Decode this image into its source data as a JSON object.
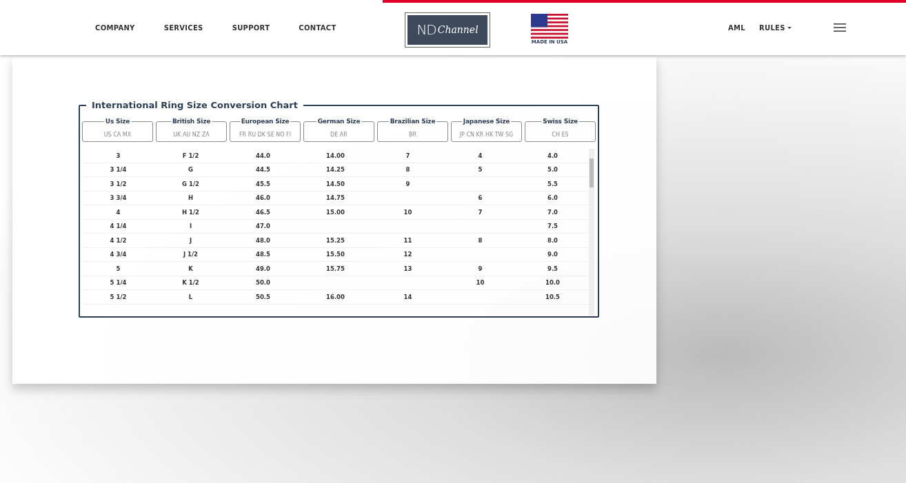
{
  "nav": {
    "left": [
      "COMPANY",
      "SERVICES",
      "SUPPORT",
      "CONTACT"
    ],
    "logo": {
      "mark": "ND",
      "word": "Channel"
    },
    "flag_label": "MADE IN USA",
    "right": [
      {
        "label": "AML",
        "kind": "link"
      },
      {
        "label": "RULES",
        "kind": "dropdown"
      }
    ]
  },
  "chart": {
    "title": "International Ring Size Conversion Chart",
    "columns": [
      {
        "title": "Us Size",
        "placeholder": "US CA MX"
      },
      {
        "title": "British Size",
        "placeholder": "UK AU NZ ZA"
      },
      {
        "title": "European Size",
        "placeholder": "FR RU DK SE NO FI"
      },
      {
        "title": "German Size",
        "placeholder": "DE AR"
      },
      {
        "title": "Brazilian Size",
        "placeholder": "BR"
      },
      {
        "title": "Japanese Size",
        "placeholder": "JP CN KR HK TW SG"
      },
      {
        "title": "Swiss Size",
        "placeholder": "CH ES"
      }
    ],
    "rows": [
      [
        "3",
        "F 1/2",
        "44.0",
        "14.00",
        "7",
        "4",
        "4.0"
      ],
      [
        "3 1/4",
        "G",
        "44.5",
        "14.25",
        "8",
        "5",
        "5.0"
      ],
      [
        "3 1/2",
        "G 1/2",
        "45.5",
        "14.50",
        "9",
        null,
        "5.5"
      ],
      [
        "3 3/4",
        "H",
        "46.0",
        "14.75",
        null,
        "6",
        "6.0"
      ],
      [
        "4",
        "H 1/2",
        "46.5",
        "15.00",
        "10",
        "7",
        "7.0"
      ],
      [
        "4 1/4",
        "I",
        "47.0",
        null,
        null,
        null,
        "7.5"
      ],
      [
        "4 1/2",
        "J",
        "48.0",
        "15.25",
        "11",
        "8",
        "8.0"
      ],
      [
        "4 3/4",
        "J 1/2",
        "48.5",
        "15.50",
        "12",
        null,
        "9.0"
      ],
      [
        "5",
        "K",
        "49.0",
        "15.75",
        "13",
        "9",
        "9.5"
      ],
      [
        "5 1/4",
        "K 1/2",
        "50.0",
        null,
        null,
        "10",
        "10.0"
      ],
      [
        "5 1/2",
        "L",
        "50.5",
        "16.00",
        "14",
        null,
        "10.5"
      ]
    ]
  }
}
